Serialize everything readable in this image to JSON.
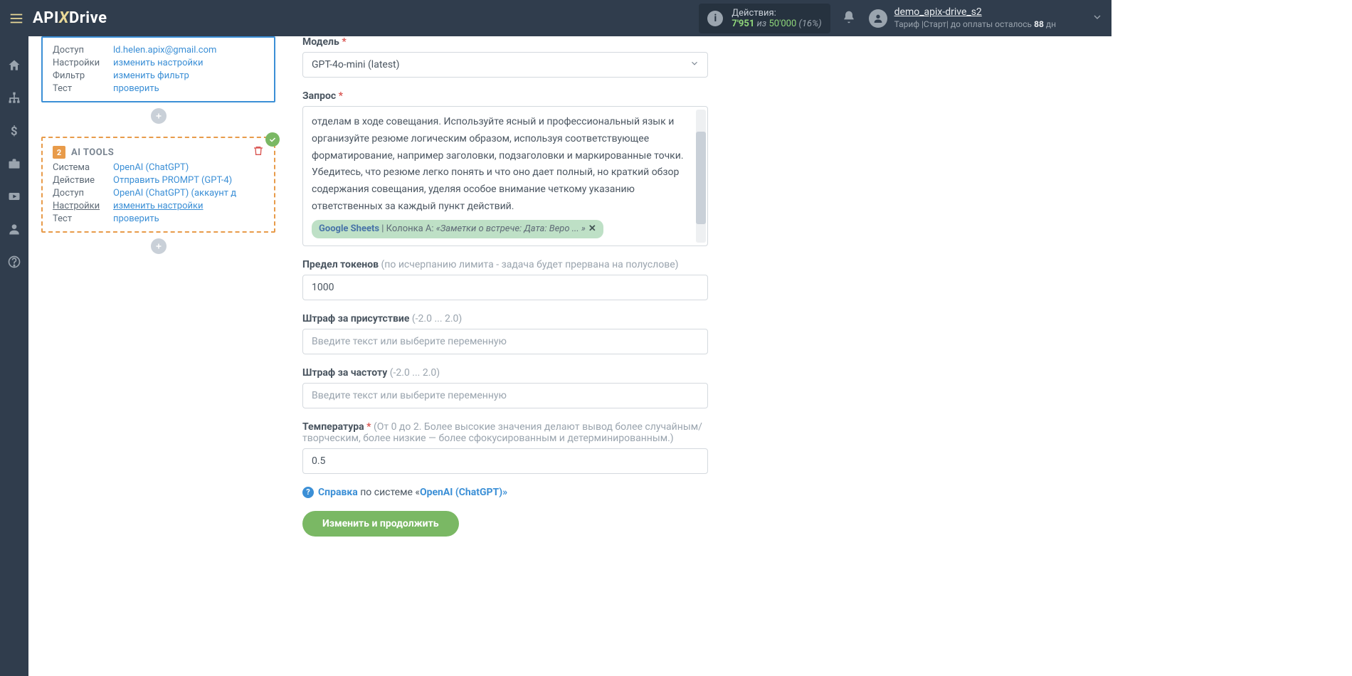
{
  "header": {
    "actions_label": "Действия:",
    "actions_count": "7'951",
    "actions_of": "из",
    "actions_max": "50'000",
    "actions_pct": "(16%)",
    "username": "demo_apix-drive_s2",
    "tariff_prefix": "Тариф |Старт| до оплаты осталось",
    "tariff_days": "88",
    "tariff_suffix": "дн"
  },
  "step1": {
    "access_label": "Доступ",
    "access_value": "ld.helen.apix@gmail.com",
    "settings_label": "Настройки",
    "settings_value": "изменить настройки",
    "filter_label": "Фильтр",
    "filter_value": "изменить фильтр",
    "test_label": "Тест",
    "test_value": "проверить"
  },
  "step2": {
    "num": "2",
    "title": "AI TOOLS",
    "system_label": "Система",
    "system_value": "OpenAI (ChatGPT)",
    "action_label": "Действие",
    "action_value": "Отправить PROMPT (GPT-4)",
    "access_label": "Доступ",
    "access_value": "OpenAI (ChatGPT) (аккаунт д",
    "settings_label": "Настройки",
    "settings_value": "изменить настройки",
    "test_label": "Тест",
    "test_value": "проверить"
  },
  "form": {
    "model_label": "Модель",
    "model_value": "GPT-4o-mini (latest)",
    "query_label": "Запрос",
    "query_text": "отделам в ходе совещания. Используйте ясный и профессиональный язык и организуйте резюме логическим образом, используя соответствующее форматирование, например заголовки, подзаголовки и маркированные точки. Убедитесь, что резюме легко понять и что оно дает полный, но краткий обзор содержания совещания, уделяя особое внимание четкому указанию ответственных за каждый пункт действий.",
    "tag_source": "Google Sheets",
    "tag_column": " | Колонка A: ",
    "tag_value": "«Заметки о встрече: Дата: Веро ... »",
    "tokens_label": "Предел токенов",
    "tokens_hint": "(по исчерпанию лимита - задача будет прервана на полуслове)",
    "tokens_value": "1000",
    "presence_label": "Штраф за присутствие",
    "presence_hint": "(-2.0 ... 2.0)",
    "presence_placeholder": "Введите текст или выберите переменную",
    "frequency_label": "Штраф за частоту",
    "frequency_hint": "(-2.0 ... 2.0)",
    "frequency_placeholder": "Введите текст или выберите переменную",
    "temp_label": "Температура",
    "temp_hint": "(От 0 до 2. Более высокие значения делают вывод более случайным/творческим, более низкие — более сфокусированным и детерминированным.)",
    "temp_value": "0.5",
    "help_prefix": "Справка",
    "help_mid": " по системе «",
    "help_link": "OpenAI (ChatGPT)»",
    "submit": "Изменить и продолжить"
  }
}
